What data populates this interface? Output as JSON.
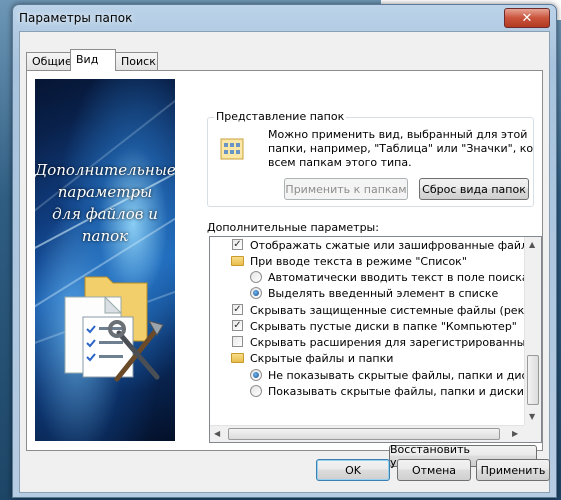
{
  "window": {
    "title": "Параметры папок",
    "close_label": "✕"
  },
  "tabs": [
    {
      "label": "Общие",
      "active": false
    },
    {
      "label": "Вид",
      "active": true
    },
    {
      "label": "Поиск",
      "active": false
    }
  ],
  "side_panel": {
    "title_lines": [
      "Дополнительные",
      "параметры",
      "для файлов и",
      "папок"
    ]
  },
  "folder_views": {
    "group_title": "Представление папок",
    "description": "Можно применить вид, выбранный для этой папки, например, \"Таблица\" или \"Значки\", ко всем папкам этого типа.",
    "apply_button": "Применить к папкам",
    "reset_button": "Сброс вида папок"
  },
  "advanced": {
    "label": "Дополнительные параметры:",
    "items": [
      {
        "kind": "checkbox",
        "checked": true,
        "indent": 1,
        "text": "Отображать сжатые или зашифрованные файлы NTFS"
      },
      {
        "kind": "folder",
        "indent": 1,
        "text": "При вводе текста в режиме \"Список\""
      },
      {
        "kind": "radio",
        "checked": false,
        "indent": 2,
        "text": "Автоматически вводить текст в поле поиска"
      },
      {
        "kind": "radio",
        "checked": true,
        "indent": 2,
        "text": "Выделять введенный элемент в списке"
      },
      {
        "kind": "checkbox",
        "checked": true,
        "indent": 1,
        "text": "Скрывать защищенные системные файлы (рекоменду"
      },
      {
        "kind": "checkbox",
        "checked": true,
        "indent": 1,
        "text": "Скрывать пустые диски в папке \"Компьютер\""
      },
      {
        "kind": "checkbox",
        "checked": false,
        "indent": 1,
        "text": "Скрывать расширения для зарегистрированных типов"
      },
      {
        "kind": "folder",
        "indent": 1,
        "text": "Скрытые файлы и папки"
      },
      {
        "kind": "radio",
        "checked": true,
        "indent": 2,
        "text": "Не показывать скрытые файлы, папки и диски"
      },
      {
        "kind": "radio",
        "checked": false,
        "indent": 2,
        "text": "Показывать скрытые файлы, папки и диски"
      }
    ],
    "restore_button": "Восстановить умолчания"
  },
  "footer": {
    "ok": "OK",
    "cancel": "Отмена",
    "apply": "Применить"
  }
}
